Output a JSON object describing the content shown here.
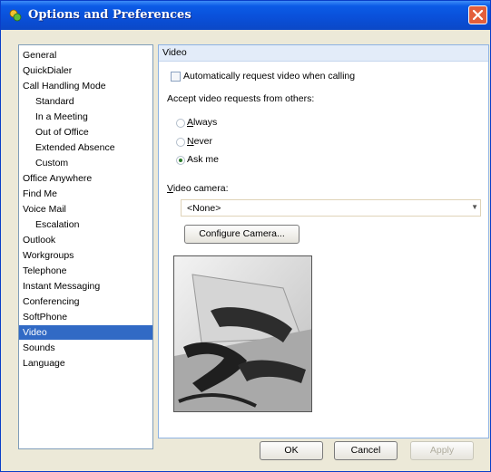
{
  "window": {
    "title": "Options and Preferences"
  },
  "nav": {
    "items": [
      {
        "label": "General",
        "indent": false
      },
      {
        "label": "QuickDialer",
        "indent": false
      },
      {
        "label": "Call Handling Mode",
        "indent": false
      },
      {
        "label": "Standard",
        "indent": true
      },
      {
        "label": "In a Meeting",
        "indent": true
      },
      {
        "label": "Out of Office",
        "indent": true
      },
      {
        "label": "Extended Absence",
        "indent": true
      },
      {
        "label": "Custom",
        "indent": true
      },
      {
        "label": "Office Anywhere",
        "indent": false
      },
      {
        "label": "Find Me",
        "indent": false
      },
      {
        "label": "Voice Mail",
        "indent": false
      },
      {
        "label": "Escalation",
        "indent": true
      },
      {
        "label": "Outlook",
        "indent": false
      },
      {
        "label": "Workgroups",
        "indent": false
      },
      {
        "label": "Telephone",
        "indent": false
      },
      {
        "label": "Instant Messaging",
        "indent": false
      },
      {
        "label": "Conferencing",
        "indent": false
      },
      {
        "label": "SoftPhone",
        "indent": false
      },
      {
        "label": "Video",
        "indent": false,
        "selected": true
      },
      {
        "label": "Sounds",
        "indent": false
      },
      {
        "label": "Language",
        "indent": false
      }
    ]
  },
  "panel": {
    "title": "Video",
    "auto_request_label": "Automatically request video when calling",
    "auto_request_checked": false,
    "accept_label": "Accept video requests from others:",
    "options": [
      {
        "label": "Always",
        "checked": false
      },
      {
        "label": "Never",
        "checked": false
      },
      {
        "label": "Ask me",
        "checked": true
      }
    ],
    "camera_label": "Video camera:",
    "camera_value": "<None>",
    "configure_label": "Configure Camera..."
  },
  "footer": {
    "ok_label": "OK",
    "cancel_label": "Cancel",
    "apply_label": "Apply"
  },
  "colors": {
    "title_blue": "#0a4fd8",
    "selection": "#316ac5",
    "panel_header": "#e3ecf9"
  }
}
